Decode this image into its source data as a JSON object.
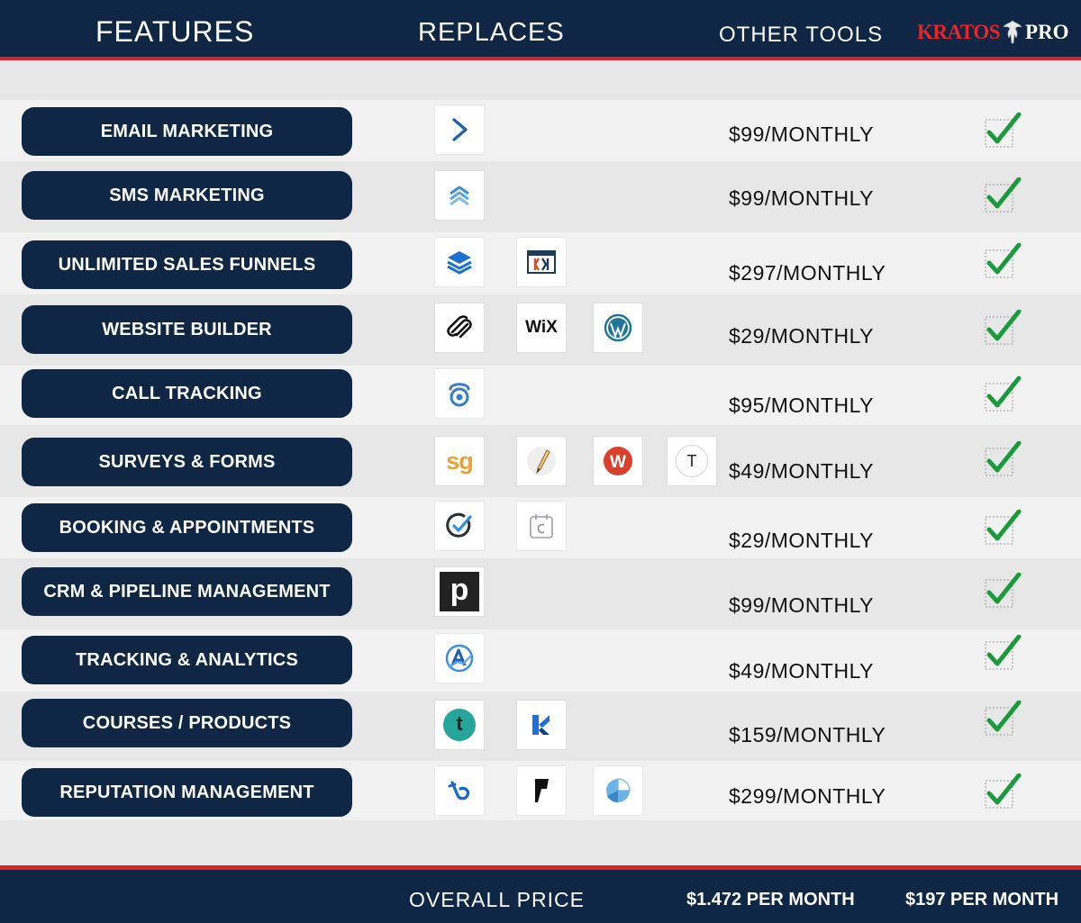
{
  "header": {
    "features": "FEATURES",
    "replaces": "REPLACES",
    "other_tools": "OTHER TOOLS",
    "brand_name": "KRATOS",
    "brand_suffix": "PRO"
  },
  "colors": {
    "navy": "#0f2644",
    "accent_red": "#d6232a",
    "check_green": "#1a9a3c"
  },
  "rows": [
    {
      "feature": "EMAIL MARKETING",
      "logos": [
        "activecampaign-icon"
      ],
      "price": "$99/MONTHLY",
      "included": true
    },
    {
      "feature": "SMS MARKETING",
      "logos": [
        "sms-chevrons-icon"
      ],
      "price": "$99/MONTHLY",
      "included": true
    },
    {
      "feature": "UNLIMITED SALES FUNNELS",
      "logos": [
        "layers-stack-icon",
        "clickfunnels-icon"
      ],
      "price": "$297/MONTHLY",
      "included": true
    },
    {
      "feature": "WEBSITE BUILDER",
      "logos": [
        "squarespace-icon",
        "wix-icon",
        "wordpress-icon"
      ],
      "price": "$29/MONTHLY",
      "included": true
    },
    {
      "feature": "CALL TRACKING",
      "logos": [
        "call-tracking-icon"
      ],
      "price": "$95/MONTHLY",
      "included": true
    },
    {
      "feature": "SURVEYS & FORMS",
      "logos": [
        "surveygizmo-icon",
        "pencil-icon",
        "wufoo-icon",
        "typeform-icon"
      ],
      "price": "$49/MONTHLY",
      "included": true
    },
    {
      "feature": "BOOKING & APPOINTMENTS",
      "logos": [
        "acuity-icon",
        "calendar-icon"
      ],
      "price": "$29/MONTHLY",
      "included": true
    },
    {
      "feature": "CRM & PIPELINE MANAGEMENT",
      "logos": [
        "pipedrive-icon"
      ],
      "price": "$99/MONTHLY",
      "included": true
    },
    {
      "feature": "TRACKING & ANALYTICS",
      "logos": [
        "analytics-arrow-icon"
      ],
      "price": "$49/MONTHLY",
      "included": true
    },
    {
      "feature": "COURSES / PRODUCTS",
      "logos": [
        "teachable-icon",
        "kajabi-icon"
      ],
      "price": "$159/MONTHLY",
      "included": true
    },
    {
      "feature": "REPUTATION MANAGEMENT",
      "logos": [
        "birdeye-icon",
        "foursquare-icon",
        "pie-chart-icon"
      ],
      "price": "$299/MONTHLY",
      "included": true
    }
  ],
  "wix_text": "WiX",
  "typeform_text": "T",
  "pipedrive_text": "p",
  "surveygizmo_text": "sg",
  "teachable_text": "t",
  "footer": {
    "label": "OVERALL PRICE",
    "other_total": "$1.472 PER MONTH",
    "kratos_total": "$197 PER MONTH"
  }
}
